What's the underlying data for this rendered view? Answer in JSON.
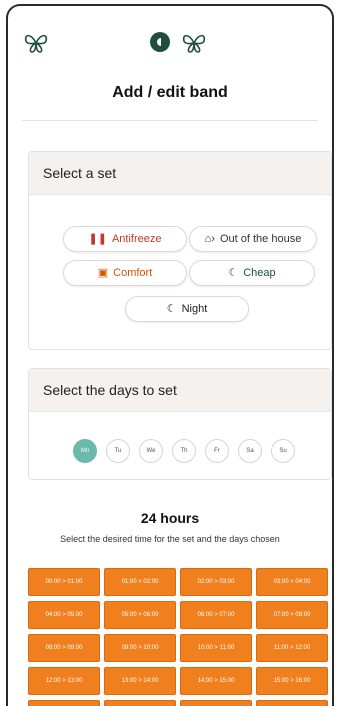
{
  "header": {
    "title": "Add / edit band"
  },
  "sets": {
    "heading": "Select a set",
    "items": [
      {
        "label": "Antifreeze",
        "icon": "antifreeze-icon",
        "glyph": "❚❚",
        "color": "#c0392b"
      },
      {
        "label": "Out of the house",
        "icon": "out-of-house-icon",
        "glyph": "⌂›",
        "color": "#333333"
      },
      {
        "label": "Comfort",
        "icon": "comfort-icon",
        "glyph": "▣",
        "color": "#d35400"
      },
      {
        "label": "Cheap",
        "icon": "cheap-icon",
        "glyph": "☾",
        "color": "#1f4f3c"
      },
      {
        "label": "Night",
        "icon": "moon-icon",
        "glyph": "☾",
        "color": "#222222"
      }
    ]
  },
  "days": {
    "heading": "Select the days to set",
    "items": [
      "Mo",
      "Tu",
      "We",
      "Th",
      "Fr",
      "Sa",
      "Su"
    ],
    "selected_index": 0
  },
  "hours": {
    "title": "24 hours",
    "subtitle": "Select the desired time for the set and the days chosen",
    "slots": [
      "00:00 > 01:00",
      "01:00 > 02:00",
      "02:00 > 03:00",
      "03:00 > 04:00",
      "04:00 > 05:00",
      "05:00 > 06:00",
      "06:00 > 07:00",
      "07:00 > 08:00",
      "08:00 > 09:00",
      "09:00 > 10:00",
      "10:00 > 11:00",
      "11:00 > 12:00",
      "12:00 > 13:00",
      "13:00 > 14:00",
      "14:00 > 15:00",
      "15:00 > 16:00",
      "",
      "",
      "",
      ""
    ]
  },
  "colors": {
    "accent": "#1f4f3c",
    "slot": "#f07f1e",
    "day_selected": "#6ab9ac"
  }
}
